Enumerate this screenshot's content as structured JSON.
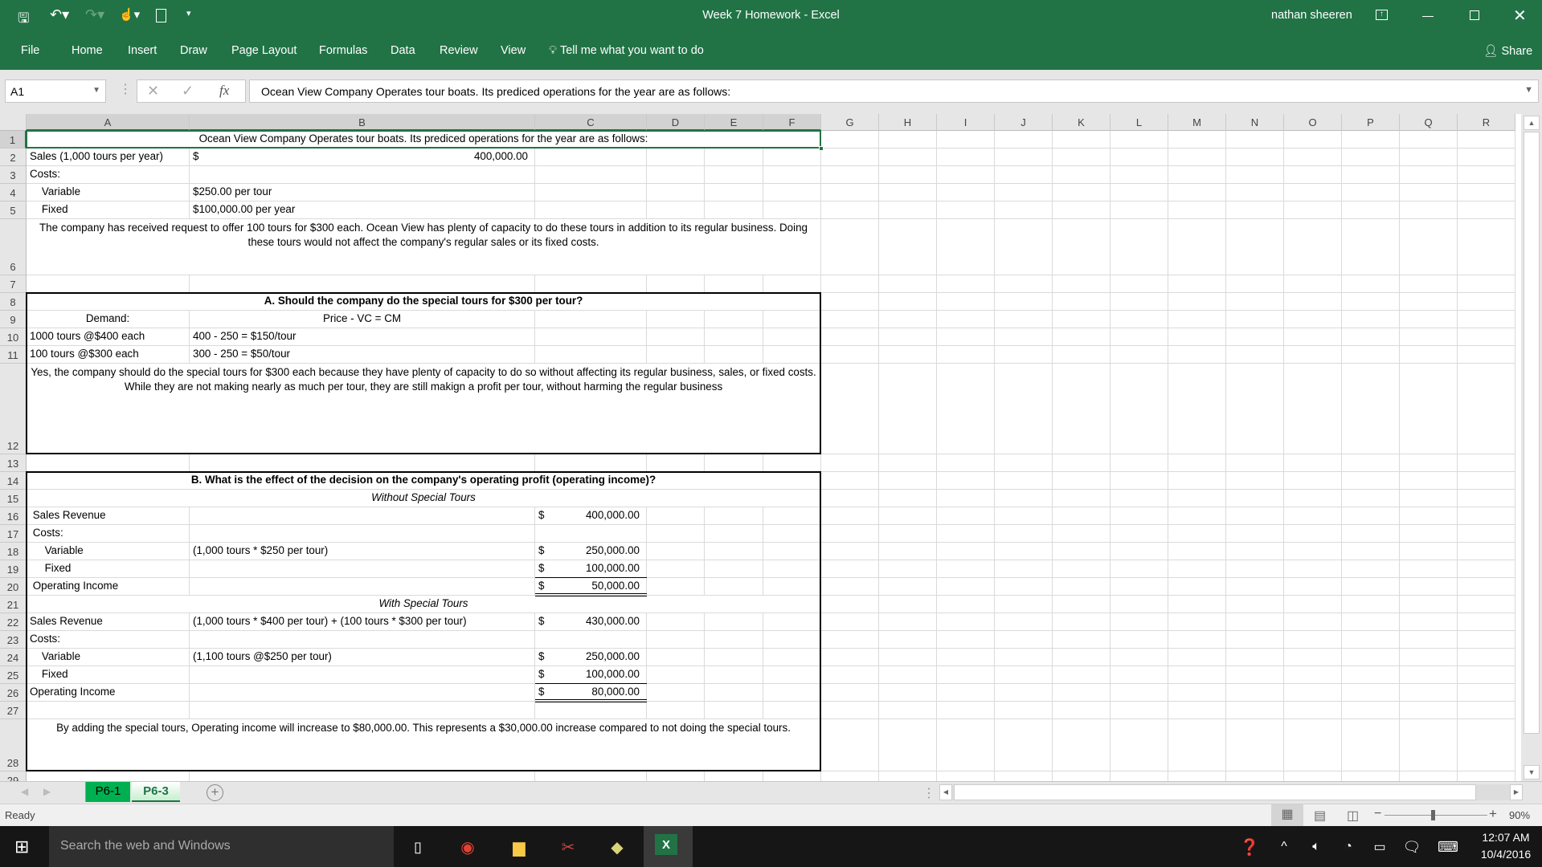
{
  "window": {
    "title": "Week 7 Homework - Excel",
    "user": "nathan sheeren",
    "share_label": "Share"
  },
  "qat": [
    "save-icon",
    "undo-icon",
    "redo-icon",
    "touch-mode-icon",
    "new-file-icon",
    "customize-icon"
  ],
  "ribbon": {
    "tabs": [
      "File",
      "Home",
      "Insert",
      "Draw",
      "Page Layout",
      "Formulas",
      "Data",
      "Review",
      "View"
    ],
    "tell_me": "Tell me what you want to do"
  },
  "formula_bar": {
    "name_box": "A1",
    "fx": "fx",
    "formula": "Ocean View Company Operates tour boats. Its prediced operations for the year are as follows:"
  },
  "columns": [
    "A",
    "B",
    "C",
    "D",
    "E",
    "F",
    "G",
    "H",
    "I",
    "J",
    "K",
    "L",
    "M",
    "N",
    "O",
    "P",
    "Q",
    "R"
  ],
  "rows": [
    "1",
    "2",
    "3",
    "4",
    "5",
    "6",
    "7",
    "8",
    "9",
    "10",
    "11",
    "12",
    "13",
    "14",
    "15",
    "16",
    "17",
    "18",
    "19",
    "20",
    "21",
    "22",
    "23",
    "24",
    "25",
    "26",
    "27",
    "28",
    "29"
  ],
  "cells": [
    {
      "ref": "A1:F1",
      "text": "Ocean View Company Operates tour boats. Its prediced operations for the year are as follows:",
      "align": "center"
    },
    {
      "ref": "A2",
      "text": "Sales (1,000 tours per year)"
    },
    {
      "ref": "B2",
      "text": "$"
    },
    {
      "ref": "B2",
      "text": "400,000.00",
      "align": "right"
    },
    {
      "ref": "A3",
      "text": "Costs:"
    },
    {
      "ref": "A4",
      "text": "    Variable",
      "indent": true
    },
    {
      "ref": "B4",
      "text": "$250.00 per tour"
    },
    {
      "ref": "A5",
      "text": "    Fixed",
      "indent": true
    },
    {
      "ref": "B5",
      "text": "$100,000.00 per year"
    },
    {
      "ref": "A6:F6",
      "text": "The company has received  request to offer 100 tours for $300 each. Ocean View has plenty of capacity to do these tours in addition to its regular business. Doing these tours would not affect the company's regular sales or its fixed costs.",
      "wrap": true
    },
    {
      "ref": "A8:F8",
      "text": "A. Should the company do the special tours for $300 per tour?",
      "align": "center",
      "bold": true
    },
    {
      "ref": "A9",
      "text": "Demand:",
      "align": "center"
    },
    {
      "ref": "B9",
      "text": "Price - VC = CM",
      "align": "center"
    },
    {
      "ref": "A10",
      "text": "1000 tours @$400 each"
    },
    {
      "ref": "B10",
      "text": "400 - 250 = $150/tour"
    },
    {
      "ref": "A11",
      "text": "100 tours @$300 each"
    },
    {
      "ref": "B11",
      "text": "300 - 250 = $50/tour"
    },
    {
      "ref": "A12:F12",
      "text": "Yes, the company should do the special tours for $300 each because they have plenty of capacity to do so without affecting its regular business, sales, or fixed costs. While they are not making nearly as much per tour, they are still makign a profit per tour, without harming the regular business",
      "wrap": true
    },
    {
      "ref": "A14:F14",
      "text": "B. What is the effect of the decision on the company's operating profit (operating income)?",
      "align": "center",
      "bold": true
    },
    {
      "ref": "A15:F15",
      "text": "Without Special Tours",
      "align": "center",
      "italic": true
    },
    {
      "ref": "A16",
      "text": " Sales Revenue"
    },
    {
      "ref": "C16",
      "text": "$"
    },
    {
      "ref": "C16",
      "text": "400,000.00",
      "align": "right"
    },
    {
      "ref": "A17",
      "text": " Costs:"
    },
    {
      "ref": "A18",
      "text": "     Variable",
      "indent": true
    },
    {
      "ref": "B18",
      "text": "(1,000 tours * $250 per tour)"
    },
    {
      "ref": "C18",
      "text": "$"
    },
    {
      "ref": "C18",
      "text": "250,000.00",
      "align": "right"
    },
    {
      "ref": "A19",
      "text": "     Fixed",
      "indent": true
    },
    {
      "ref": "C19",
      "text": "$"
    },
    {
      "ref": "C19",
      "text": "100,000.00",
      "align": "right"
    },
    {
      "ref": "A20",
      "text": " Operating Income"
    },
    {
      "ref": "C20",
      "text": "$"
    },
    {
      "ref": "C20",
      "text": "50,000.00",
      "align": "right"
    },
    {
      "ref": "A21:F21",
      "text": "With Special Tours",
      "align": "center",
      "italic": true
    },
    {
      "ref": "A22",
      "text": "Sales Revenue"
    },
    {
      "ref": "B22",
      "text": "(1,000 tours * $400 per tour) + (100 tours * $300 per tour)"
    },
    {
      "ref": "C22",
      "text": "$"
    },
    {
      "ref": "C22",
      "text": "430,000.00",
      "align": "right"
    },
    {
      "ref": "A23",
      "text": "Costs:"
    },
    {
      "ref": "A24",
      "text": "    Variable",
      "indent": true
    },
    {
      "ref": "B24",
      "text": "(1,100 tours @$250 per tour)"
    },
    {
      "ref": "C24",
      "text": "$"
    },
    {
      "ref": "C24",
      "text": "250,000.00",
      "align": "right"
    },
    {
      "ref": "A25",
      "text": "    Fixed",
      "indent": true
    },
    {
      "ref": "C25",
      "text": "$"
    },
    {
      "ref": "C25",
      "text": "100,000.00",
      "align": "right"
    },
    {
      "ref": "A26",
      "text": "Operating Income"
    },
    {
      "ref": "C26",
      "text": "$"
    },
    {
      "ref": "C26",
      "text": "80,000.00",
      "align": "right"
    },
    {
      "ref": "A28:F28",
      "text": "By adding the special tours, Operating income will increase to $80,000.00. This represents a $30,000.00 increase compared to not doing the special tours.",
      "wrap": true
    }
  ],
  "borders": {
    "thick_boxes": [
      "A8:F12",
      "A14:F28"
    ],
    "single_bottom": [
      "C19",
      "C25"
    ],
    "double_bottom": [
      "C20",
      "C26"
    ]
  },
  "selected_cell": "A1:F1",
  "sheets": [
    {
      "name": "P6-1",
      "color": "#00b050",
      "active": false
    },
    {
      "name": "P6-3",
      "active": true
    }
  ],
  "status": {
    "text": "Ready",
    "zoom": "90%",
    "zoom_level": 90
  },
  "taskbar": {
    "search_placeholder": "Search the web and Windows",
    "time": "12:07 AM",
    "date": "10/4/2016"
  },
  "colors": {
    "excel_green": "#217346",
    "selection": "#217346",
    "tab_green": "#00b050"
  }
}
